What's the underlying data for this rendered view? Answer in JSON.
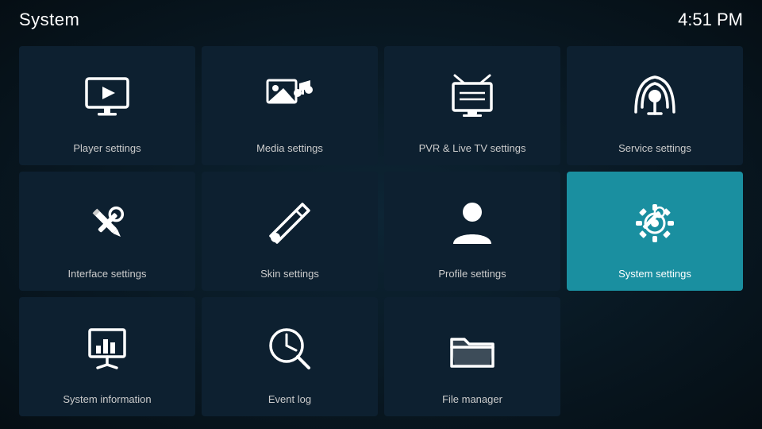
{
  "header": {
    "title": "System",
    "time": "4:51 PM"
  },
  "grid": {
    "items": [
      {
        "id": "player-settings",
        "label": "Player settings",
        "icon": "player",
        "active": false
      },
      {
        "id": "media-settings",
        "label": "Media settings",
        "icon": "media",
        "active": false
      },
      {
        "id": "pvr-settings",
        "label": "PVR & Live TV settings",
        "icon": "pvr",
        "active": false
      },
      {
        "id": "service-settings",
        "label": "Service settings",
        "icon": "service",
        "active": false
      },
      {
        "id": "interface-settings",
        "label": "Interface settings",
        "icon": "interface",
        "active": false
      },
      {
        "id": "skin-settings",
        "label": "Skin settings",
        "icon": "skin",
        "active": false
      },
      {
        "id": "profile-settings",
        "label": "Profile settings",
        "icon": "profile",
        "active": false
      },
      {
        "id": "system-settings",
        "label": "System settings",
        "icon": "system",
        "active": true
      },
      {
        "id": "system-information",
        "label": "System information",
        "icon": "sysinfo",
        "active": false
      },
      {
        "id": "event-log",
        "label": "Event log",
        "icon": "eventlog",
        "active": false
      },
      {
        "id": "file-manager",
        "label": "File manager",
        "icon": "filemanager",
        "active": false
      }
    ]
  }
}
